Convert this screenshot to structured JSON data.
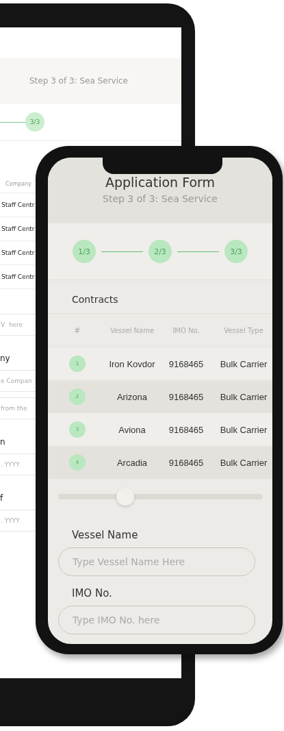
{
  "tablet": {
    "subtitle": "Step 3 of 3: Sea Service",
    "steps": [
      "3/3"
    ],
    "table": {
      "columns": [
        "Company"
      ],
      "rows": [
        "Staff Centr",
        "Staff Centr",
        "Staff Centr",
        "Staff Centr"
      ]
    },
    "fields": [
      {
        "kind": "input",
        "placeholder": "V  here"
      },
      {
        "kind": "label",
        "text": "ny"
      },
      {
        "kind": "input",
        "placeholder": "e Compan"
      },
      {
        "kind": "input",
        "placeholder": "from the"
      },
      {
        "kind": "label",
        "text": "n"
      },
      {
        "kind": "input",
        "placeholder": ". YYYY"
      },
      {
        "kind": "label",
        "text": "f"
      },
      {
        "kind": "input",
        "placeholder": ". YYYY"
      }
    ]
  },
  "phone": {
    "title": "Application Form",
    "subtitle": "Step 3 of 3: Sea Service",
    "steps": [
      "1/3",
      "2/3",
      "3/3"
    ],
    "section": "Contracts",
    "table": {
      "columns": [
        "#",
        "Vessel Name",
        "IMO No.",
        "Vessel Type"
      ],
      "rows": [
        {
          "number": "1",
          "vessel_name": "Iron Kovdor",
          "imo": "9168465",
          "vessel_type": "Bulk Carrier"
        },
        {
          "number": "2",
          "vessel_name": "Arizona",
          "imo": "9168465",
          "vessel_type": "Bulk Carrier"
        },
        {
          "number": "3",
          "vessel_name": "Aviona",
          "imo": "9168465",
          "vessel_type": "Bulk Carrier"
        },
        {
          "number": "4",
          "vessel_name": "Arcadia",
          "imo": "9168465",
          "vessel_type": "Bulk Carrier"
        }
      ]
    },
    "fields": [
      {
        "label": "Vessel Name",
        "placeholder": "Type Vessel Name Here"
      },
      {
        "label": "IMO No.",
        "placeholder": "Type IMO No. here"
      }
    ]
  }
}
